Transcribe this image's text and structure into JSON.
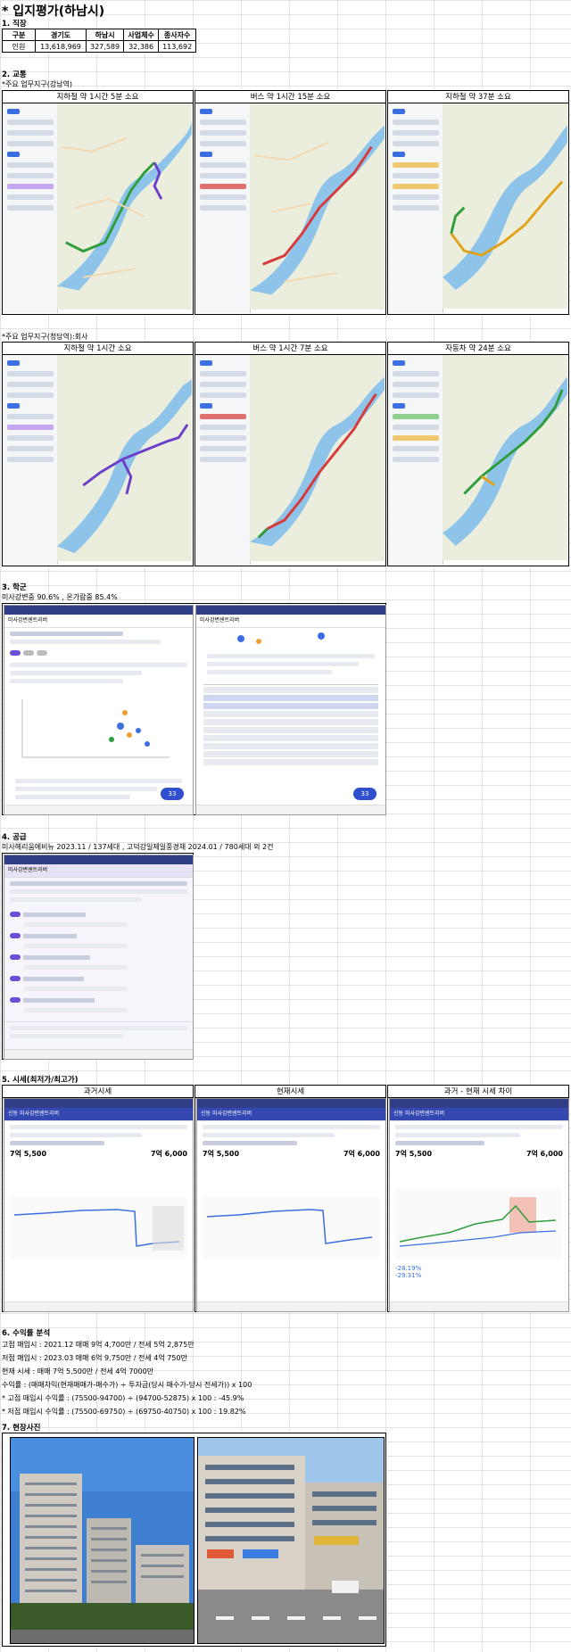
{
  "title": "* 입지평가(하남시)",
  "sections": {
    "s1": "1. 직장",
    "s2": "2. 교통",
    "s3": "3. 학군",
    "s4": "4. 공급",
    "s5": "5. 시세(최저가/최고가)",
    "s6": "6. 수익률 분석",
    "s7": "7. 현장사진"
  },
  "population": {
    "headers": [
      "구분",
      "경기도",
      "하남시",
      "사업체수",
      "종사자수"
    ],
    "row": [
      "인원",
      "13,618,969",
      "327,589",
      "32,386",
      "113,692"
    ]
  },
  "transport": {
    "gangnam_label": "*주요 업무지구(강남역)",
    "cheongdam_label": "*주요 업무지구(청담역):회사",
    "gangnam_caps": [
      "지하철 약 1시간 5분 소요",
      "버스 약 1시간 15분 소요",
      "지하철 약 37분 소요"
    ],
    "cheongdam_caps": [
      "지하철 약 1시간 소요",
      "버스 약 1시간 7분 소요",
      "자동차 약 24분 소요"
    ]
  },
  "school": {
    "note": "미사강변중 90.6% , 온가람중 85.4%",
    "app_title": "미사강변센트리버",
    "badge": "33"
  },
  "supply": {
    "note": "미사헤리움에비뉴 2023.11 / 137세대 , 고덕강일제일풍경채 2024.01 / 780세대 외 2건",
    "app_title": "미사강변센트리버"
  },
  "price": {
    "caps": [
      "과거시세",
      "현재시세",
      "과거 - 현재 시세 차이"
    ],
    "app_title": "신동 미사강변센트리버",
    "left_val": "7억 5,500",
    "right_val": "7억 6,000",
    "diff_a": "-28.19%",
    "diff_b": "-29.31%"
  },
  "roi": {
    "lines": [
      "고점 매입시 : 2021.12 매매 9억 4,700만 / 전세 5억 2,875만",
      "저점 매입시 : 2023.03 매매 6억 9,750만 / 전세 4억 750만",
      "현재 시세 : 매매 7억 5,500만 / 전세 4억 7000만",
      "수익률 : (매매차익(현재매매가-매수가) ÷ 투자금(당시 매수가-당시 전세가)) x 100",
      "* 고점 매입시 수익률 : (75500-94700) ÷ (94700-52875) x 100 : -45.9%",
      "* 저점 매입시 수익률 : (75500-69750) ÷ (69750-40750) x 100 : 19.82%"
    ]
  },
  "colors": {
    "route_purple": "#6b3fc9",
    "route_red": "#d63a3a",
    "route_green": "#2e9d3a",
    "route_orange": "#e0a21a",
    "river": "#8fc4ea"
  }
}
